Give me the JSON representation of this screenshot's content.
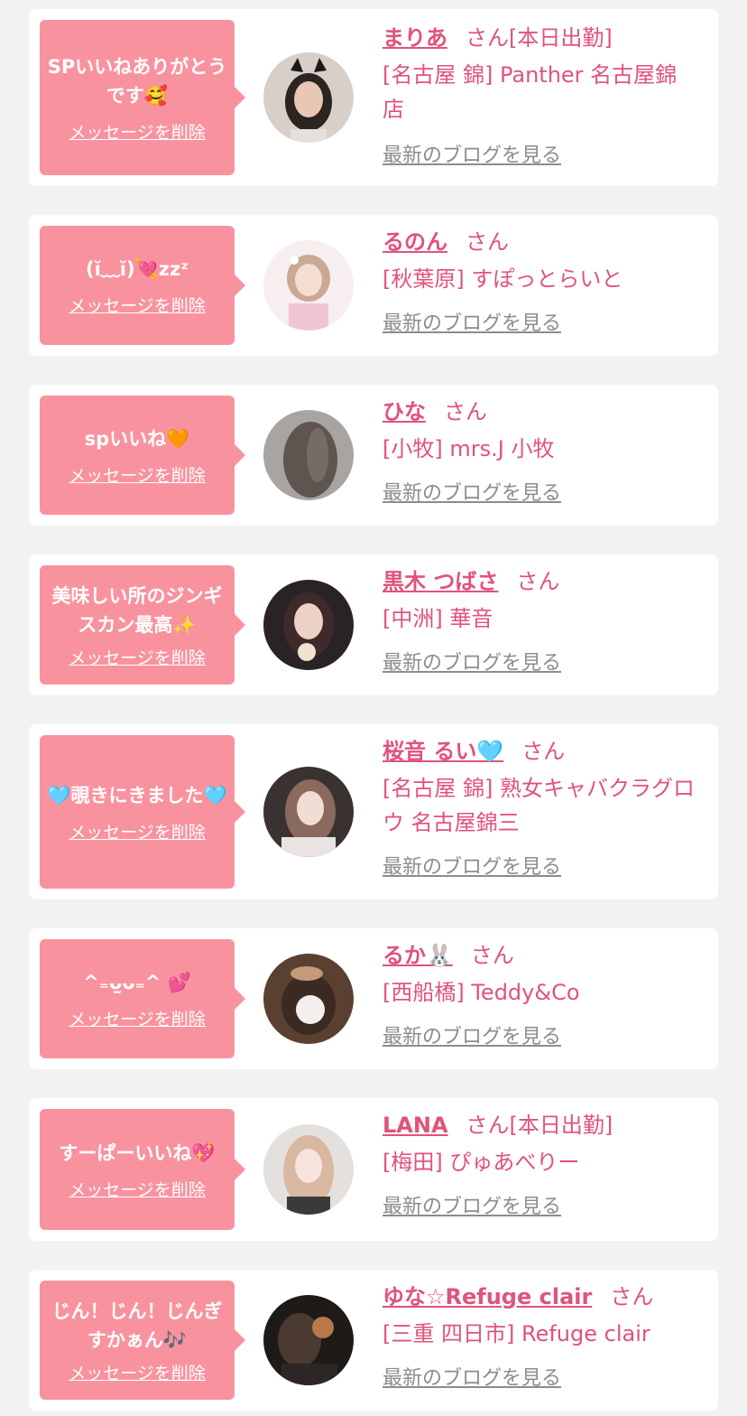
{
  "colors": {
    "accent": "#e0537b",
    "bubble": "#f9929f",
    "muted": "#8c8c8c",
    "background": "#f2f2f2"
  },
  "cards": [
    {
      "message": "SPいいねありがとうです🥰",
      "delete_label": "メッセージを削除",
      "name": "まりあ",
      "suffix": "さん",
      "status": "[本日出勤]",
      "shop": "[名古屋 錦] Panther 名古屋錦店",
      "blog_label": "最新のブログを見る"
    },
    {
      "message": "(ĭ﹏ĭ)💘zzᶻ",
      "delete_label": "メッセージを削除",
      "name": "るのん",
      "suffix": "さん",
      "status": "",
      "shop": "[秋葉原] すぽっとらいと",
      "blog_label": "最新のブログを見る"
    },
    {
      "message": "spいいね🧡",
      "delete_label": "メッセージを削除",
      "name": "ひな",
      "suffix": "さん",
      "status": "",
      "shop": "[小牧] mrs.J 小牧",
      "blog_label": "最新のブログを見る"
    },
    {
      "message": "美味しい所のジンギスカン最高✨",
      "delete_label": "メッセージを削除",
      "name": "黒木 つばさ",
      "suffix": "さん",
      "status": "",
      "shop": "[中洲] 華音",
      "blog_label": "最新のブログを見る"
    },
    {
      "message": "🩵覗きにきました🩵",
      "delete_label": "メッセージを削除",
      "name": "桜音 るい🩵",
      "suffix": "さん",
      "status": "",
      "shop": "[名古屋 錦] 熟女キャバクラグロウ 名古屋錦三",
      "blog_label": "最新のブログを見る"
    },
    {
      "message": "^₌ᴗ̫ᴗ₌^ 💕",
      "delete_label": "メッセージを削除",
      "name": "るか🐰",
      "suffix": "さん",
      "status": "",
      "shop": "[西船橋] Teddy&Co",
      "blog_label": "最新のブログを見る"
    },
    {
      "message": "すーぱーいいね💖",
      "delete_label": "メッセージを削除",
      "name": "LANA",
      "suffix": "さん",
      "status": "[本日出勤]",
      "shop": "[梅田] ぴゅあべりー",
      "blog_label": "最新のブログを見る"
    },
    {
      "message": "じん！じん！じんぎすかぁん🎶",
      "delete_label": "メッセージを削除",
      "name": "ゆな☆Refuge clair",
      "suffix": "さん",
      "status": "",
      "shop": "[三重 四日市] Refuge clair",
      "blog_label": "最新のブログを見る"
    }
  ]
}
